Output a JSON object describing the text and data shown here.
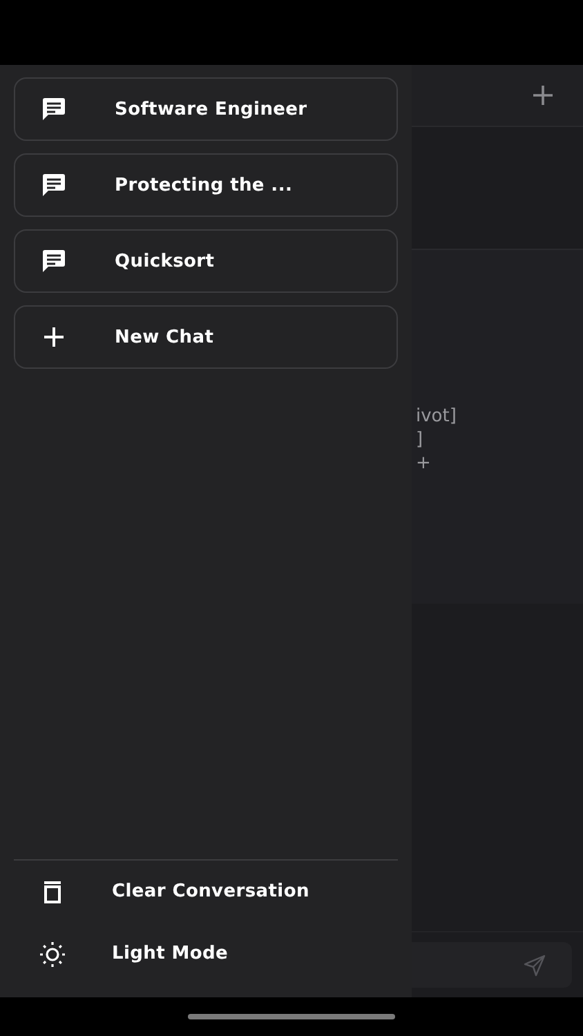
{
  "drawer": {
    "chats": [
      {
        "kind": "chat",
        "label": "Software Engineer"
      },
      {
        "kind": "chat",
        "label": "Protecting the ..."
      },
      {
        "kind": "chat",
        "label": "Quicksort"
      },
      {
        "kind": "new",
        "label": "New Chat"
      }
    ],
    "actions": [
      {
        "kind": "clear",
        "label": "Clear Conversation"
      },
      {
        "kind": "theme",
        "label": "Light Mode"
      }
    ]
  },
  "message": {
    "lines": [
      "ivot]",
      "]",
      "+"
    ]
  }
}
